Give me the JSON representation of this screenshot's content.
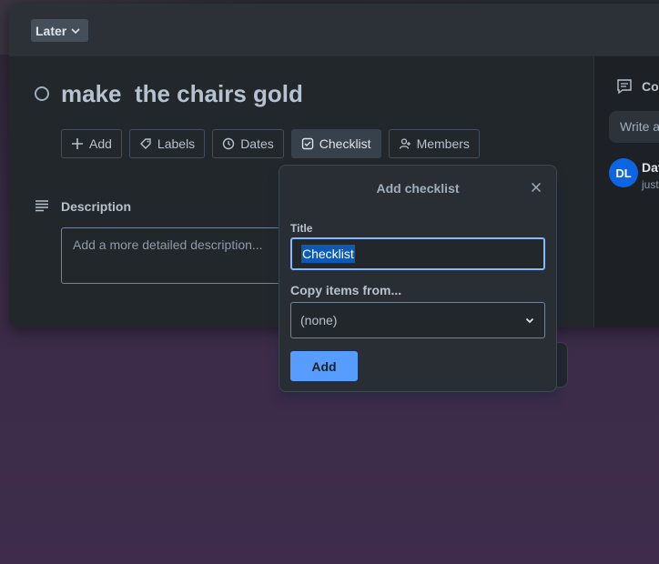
{
  "header": {
    "list_button_label": "Later"
  },
  "card": {
    "title": "make  the chairs gold",
    "actions": [
      {
        "label": "Add",
        "icon": "plus-icon"
      },
      {
        "label": "Labels",
        "icon": "tag-icon"
      },
      {
        "label": "Dates",
        "icon": "clock-icon"
      },
      {
        "label": "Checklist",
        "icon": "checkbox-icon"
      },
      {
        "label": "Members",
        "icon": "add-person-icon"
      }
    ],
    "description": {
      "label": "Description",
      "placeholder": "Add a more detailed description..."
    }
  },
  "sidebar": {
    "comments_label": "Cor",
    "comment_placeholder": "Write a",
    "activity": {
      "avatar_initials": "DL",
      "author": "Dav",
      "timestamp": "just"
    }
  },
  "popover": {
    "title": "Add checklist",
    "title_field_label": "Title",
    "title_value": "Checklist",
    "copy_from_label": "Copy items from...",
    "copy_from_value": "(none)",
    "add_button_label": "Add"
  },
  "colors": {
    "accent": "#579dff",
    "avatar": "#0c66e4",
    "selection": "#0c5ab4",
    "modal_bg": "#22272b"
  }
}
